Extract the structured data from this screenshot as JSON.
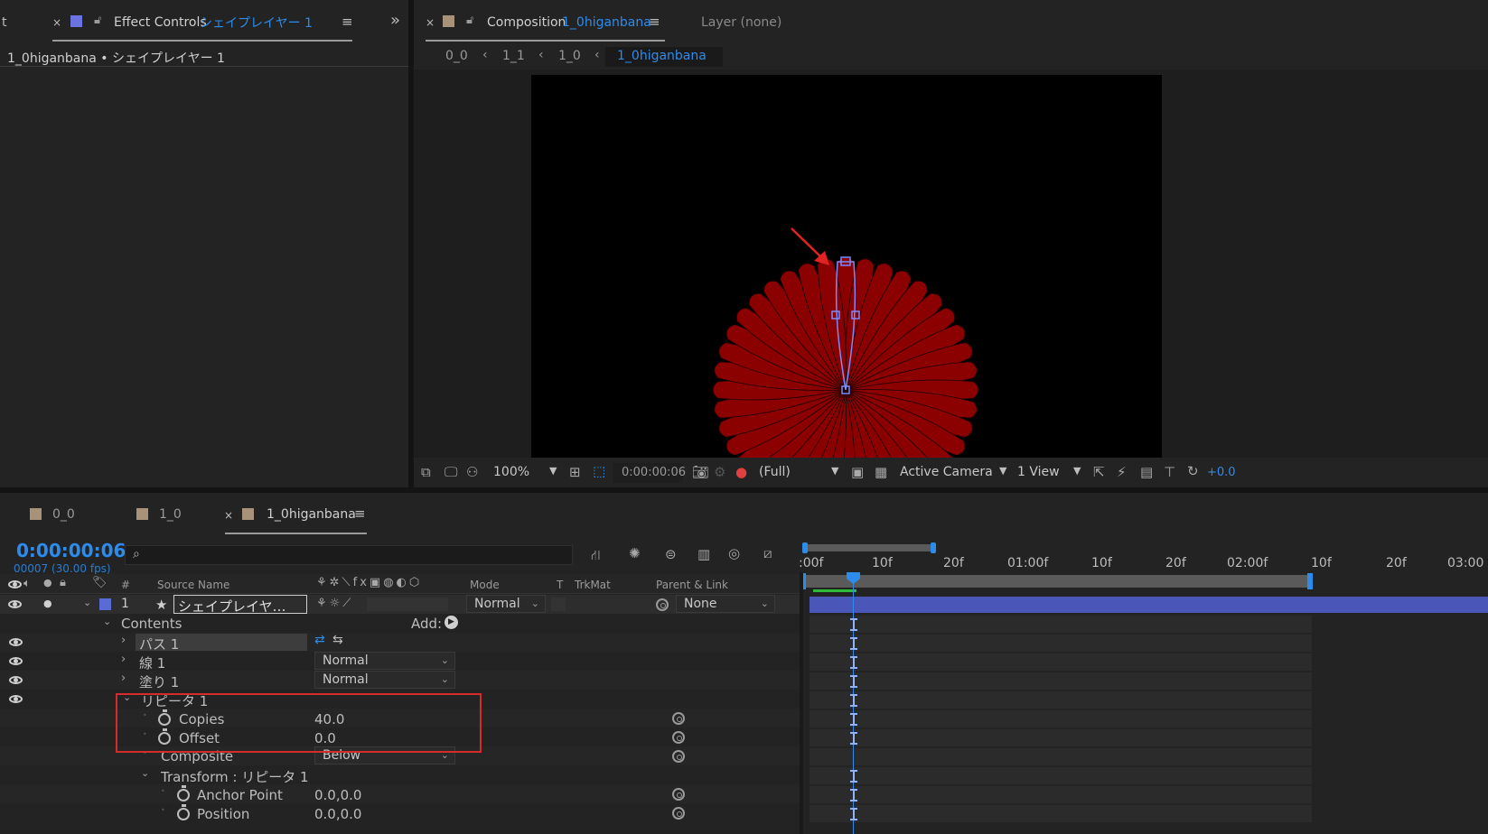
{
  "effect_controls": {
    "partial_tab": "t",
    "tab_label": "Effect Controls",
    "tab_layer": "シェイプレイヤー 1",
    "breadcrumb": "1_0higanbana • シェイプレイヤー 1",
    "expand": "»"
  },
  "composition": {
    "tab_label": "Composition",
    "tab_name": "1_0higanbana",
    "layer_tab": "Layer  (none)",
    "crumbs": [
      "0_0",
      "1_1",
      "1_0",
      "1_0higanbana"
    ],
    "zoom": "100%",
    "timecode": "0:00:00:06",
    "resolution": "(Full)",
    "camera": "Active Camera",
    "views": "1 View",
    "exposure": "+0.0"
  },
  "timeline": {
    "tabs": [
      {
        "label": "0_0",
        "color": "#a8927a"
      },
      {
        "label": "1_0",
        "color": "#a8927a"
      },
      {
        "label": "1_0higanbana",
        "color": "#a8927a"
      }
    ],
    "current_time": "0:00:00:06",
    "frame_info": "00007 (30.00 fps)",
    "search_placeholder": "",
    "ruler": [
      ":00f",
      "10f",
      "20f",
      "01:00f",
      "10f",
      "20f",
      "02:00f",
      "10f",
      "20f",
      "03:00"
    ],
    "headers": {
      "num": "#",
      "source_name": "Source Name",
      "mode": "Mode",
      "t": "T",
      "trkmat": "TrkMat",
      "parent": "Parent & Link"
    },
    "layer": {
      "number": "1",
      "name": "シェイプレイヤ…",
      "mode": "Normal",
      "parent": "None"
    },
    "contents_label": "Contents",
    "add_label": "Add:",
    "path_label": "パス 1",
    "stroke_label": "線 1",
    "stroke_mode": "Normal",
    "fill_label": "塗り 1",
    "fill_mode": "Normal",
    "repeater_label": "リピータ 1",
    "copies_label": "Copies",
    "copies_value": "40.0",
    "offset_label": "Offset",
    "offset_value": "0.0",
    "composite_label": "Composite",
    "composite_value": "Below",
    "transform_label": "Transform : リピータ 1",
    "anchor_label": "Anchor Point",
    "anchor_value": "0.0,0.0",
    "position_label": "Position",
    "position_value": "0.0,0.0"
  },
  "colors": {
    "accent_blue": "#2d8ceb",
    "petal": "#8b0000",
    "layer_label": "#5b6bd6",
    "highlight_box": "#d42b2b",
    "layer_bar": "#4a56b8"
  },
  "flower": {
    "petals": 40,
    "visible_fraction": "bottom-clipped"
  }
}
